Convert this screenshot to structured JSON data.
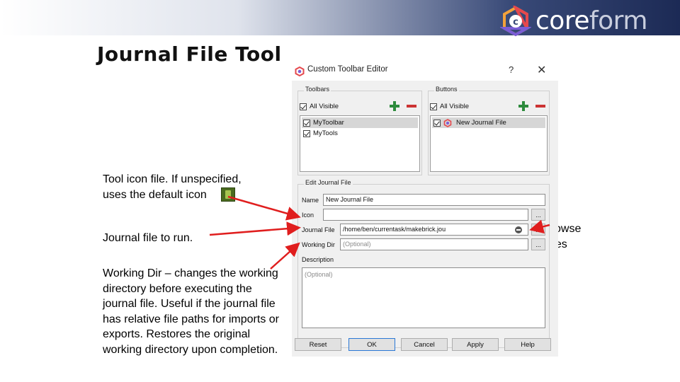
{
  "slide": {
    "title": "Journal File Tool",
    "logo_text_a": "core",
    "logo_text_b": "form",
    "notes": {
      "icon": "Tool icon file. If unspecified, uses the default icon",
      "journal": "Journal file to run.",
      "working_dir": "Working Dir – changes the working directory before executing the journal file. Useful if the journal file has relative file paths for imports or exports. Restores the original working directory upon completion.",
      "browse": "Browse Files"
    },
    "colors": {
      "arrow": "#e01e1e",
      "default_button_border": "#2a78d6"
    }
  },
  "dialog": {
    "title": "Custom Toolbar Editor",
    "help_label": "?",
    "close_label": "✕",
    "toolbars": {
      "label": "Toolbars",
      "all_visible": "All Visible",
      "items": [
        "MyToolbar",
        "MyTools"
      ]
    },
    "buttons": {
      "label": "Buttons",
      "all_visible": "All Visible",
      "items": [
        "New Journal File"
      ]
    },
    "edit": {
      "label": "Edit Journal File",
      "name_label": "Name",
      "name_value": "New Journal File",
      "icon_label": "Icon",
      "icon_value": "",
      "journal_label": "Journal File",
      "journal_value": "/home/ben/currentask/makebrick.jou",
      "workdir_label": "Working Dir",
      "workdir_placeholder": "(Optional)",
      "desc_label": "Description",
      "desc_placeholder": "(Optional)",
      "browse_label": "..."
    },
    "footer": [
      "Reset",
      "OK",
      "Cancel",
      "Apply",
      "Help"
    ]
  }
}
